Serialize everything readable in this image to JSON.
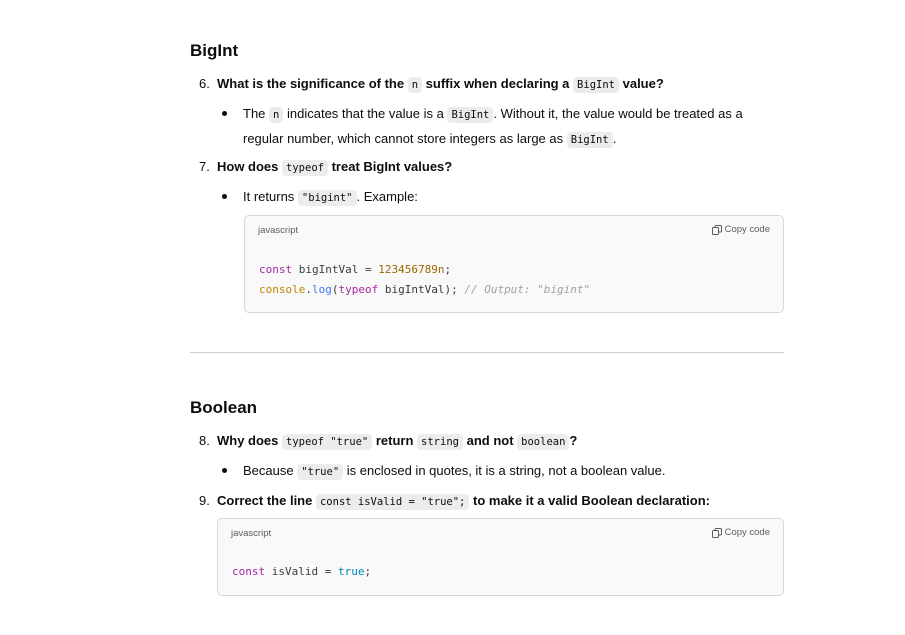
{
  "sections": {
    "bigint_heading": "BigInt",
    "boolean_heading": "Boolean"
  },
  "q6": {
    "num": "6.",
    "t1": "What is the significance of the",
    "c1": "n",
    "t2": "suffix when declaring a",
    "c2": "BigInt",
    "t3": "value?",
    "a1": "The",
    "ac1": "n",
    "a2": "indicates that the value is a",
    "ac2": "BigInt",
    "a3": ". Without it, the value would be treated as a regular number, which cannot store integers as large as",
    "ac3": "BigInt",
    "a4": "."
  },
  "q7": {
    "num": "7.",
    "t1": "How does",
    "c1": "typeof",
    "t2": "treat BigInt values?",
    "a1": "It returns",
    "ac1": "\"bigint\"",
    "a2": ". Example:"
  },
  "code1": {
    "lang": "javascript",
    "copy": "Copy code",
    "l1_kw": "const",
    "l1_var": " bigIntVal = ",
    "l1_num": "123456789n",
    "l1_end": ";",
    "l2_obj": "console",
    "l2_dot": ".",
    "l2_fn": "log",
    "l2_open": "(",
    "l2_kw": "typeof",
    "l2_rest": " bigIntVal); ",
    "l2_cm": "// Output: \"bigint\""
  },
  "q8": {
    "num": "8.",
    "t1": "Why does",
    "c1": "typeof \"true\"",
    "t2": "return",
    "c2": "string",
    "t3": "and not",
    "c3": "boolean",
    "t4": "?",
    "a1": "Because",
    "ac1": "\"true\"",
    "a2": "is enclosed in quotes, it is a string, not a boolean value."
  },
  "q9": {
    "num": "9.",
    "t1": "Correct the line",
    "c1": "const isValid = \"true\";",
    "t2": "to make it a valid Boolean declaration:"
  },
  "code2": {
    "lang": "javascript",
    "copy": "Copy code",
    "l1_kw": "const",
    "l1_var": " isValid = ",
    "l1_bool": "true",
    "l1_end": ";"
  }
}
